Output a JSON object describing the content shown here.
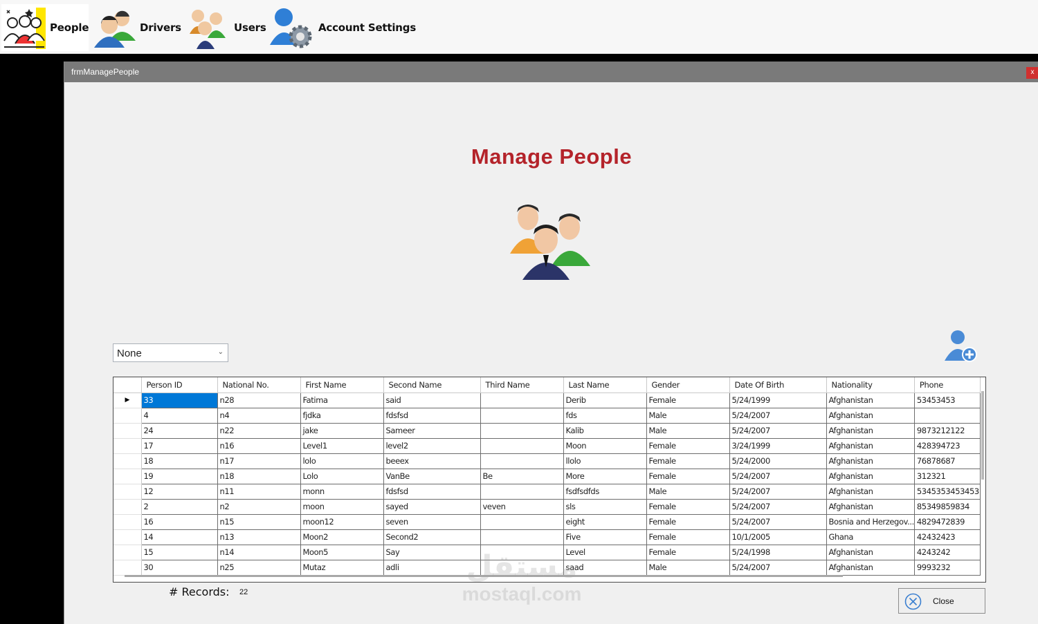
{
  "menu": {
    "items": [
      {
        "label": "People",
        "icon": "people-group-icon"
      },
      {
        "label": "Drivers",
        "icon": "drivers-icon"
      },
      {
        "label": "Users",
        "icon": "users-icon"
      },
      {
        "label": "Account Settings",
        "icon": "account-settings-icon"
      }
    ]
  },
  "window": {
    "title": "frmManagePeople",
    "close_glyph": "x",
    "heading": "Manage People",
    "filter": {
      "selected": "None"
    },
    "grid": {
      "columns": [
        "Person ID",
        "National No.",
        "First Name",
        "Second Name",
        "Third Name",
        "Last Name",
        "Gender",
        "Date Of Birth",
        "Nationality",
        "Phone"
      ],
      "rows": [
        [
          "33",
          "n28",
          "Fatima",
          "said",
          "",
          "Derib",
          "Female",
          "5/24/1999",
          "Afghanistan",
          "53453453"
        ],
        [
          "4",
          "n4",
          "fjdka",
          "fdsfsd",
          "",
          "fds",
          "Male",
          "5/24/2007",
          "Afghanistan",
          ""
        ],
        [
          "24",
          "n22",
          "jake",
          "Sameer",
          "",
          "Kalib",
          "Male",
          "5/24/2007",
          "Afghanistan",
          "9873212122"
        ],
        [
          "17",
          "n16",
          "Level1",
          "level2",
          "",
          "Moon",
          "Female",
          "3/24/1999",
          "Afghanistan",
          "428394723"
        ],
        [
          "18",
          "n17",
          "lolo",
          "beeex",
          "",
          "llolo",
          "Female",
          "5/24/2000",
          "Afghanistan",
          "76878687"
        ],
        [
          "19",
          "n18",
          "Lolo",
          "VanBe",
          "Be",
          "More",
          "Female",
          "5/24/2007",
          "Afghanistan",
          "312321"
        ],
        [
          "12",
          "n11",
          "monn",
          "fdsfsd",
          "",
          "fsdfsdfds",
          "Male",
          "5/24/2007",
          "Afghanistan",
          "5345353453453"
        ],
        [
          "2",
          "n2",
          "moon",
          "sayed",
          "veven",
          "sls",
          "Female",
          "5/24/2007",
          "Afghanistan",
          "85349859834"
        ],
        [
          "16",
          "n15",
          "moon12",
          "seven",
          "",
          "eight",
          "Female",
          "5/24/2007",
          "Bosnia and Herzegov...",
          "4829472839"
        ],
        [
          "14",
          "n13",
          "Moon2",
          "Second2",
          "",
          "Five",
          "Female",
          "10/1/2005",
          "Ghana",
          "42432423"
        ],
        [
          "15",
          "n14",
          "Moon5",
          "Say",
          "",
          "Level",
          "Female",
          "5/24/1998",
          "Afghanistan",
          "4243242"
        ],
        [
          "30",
          "n25",
          "Mutaz",
          "adli",
          "",
          "saad",
          "Male",
          "5/24/2007",
          "Afghanistan",
          "9993232"
        ]
      ],
      "current_row_marker": "▶"
    },
    "records": {
      "label": "# Records:",
      "count": "22"
    },
    "close_button": "Close"
  },
  "watermark": {
    "arabic": "مستقل",
    "latin": "mostaql.com"
  },
  "colors": {
    "heading": "#b4232a",
    "selection": "#0078d7",
    "titlebar": "#7a7a7a"
  }
}
